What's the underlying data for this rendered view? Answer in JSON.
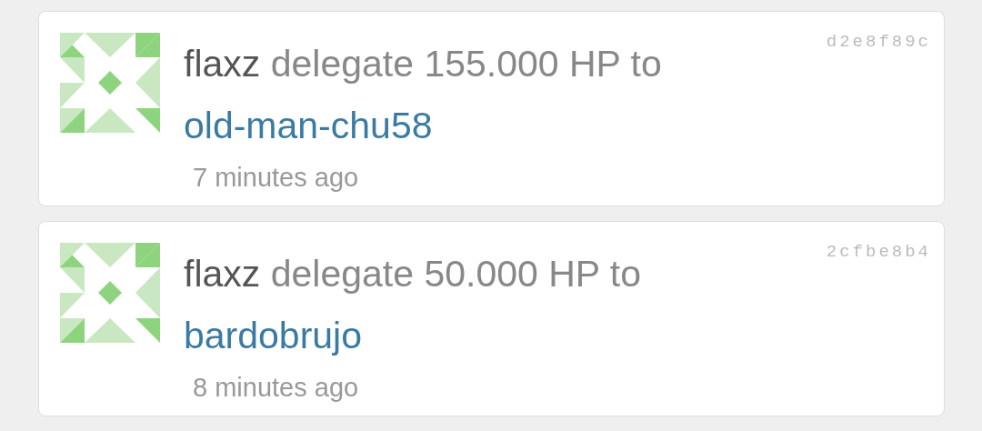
{
  "activities": [
    {
      "user": "flaxz",
      "action": "delegate 155.000 HP to",
      "target": "old-man-chu58",
      "time": "7 minutes ago",
      "hash": "d2e8f89c"
    },
    {
      "user": "flaxz",
      "action": "delegate 50.000 HP to",
      "target": "bardobrujo",
      "time": "8 minutes ago",
      "hash": "2cfbe8b4"
    }
  ]
}
